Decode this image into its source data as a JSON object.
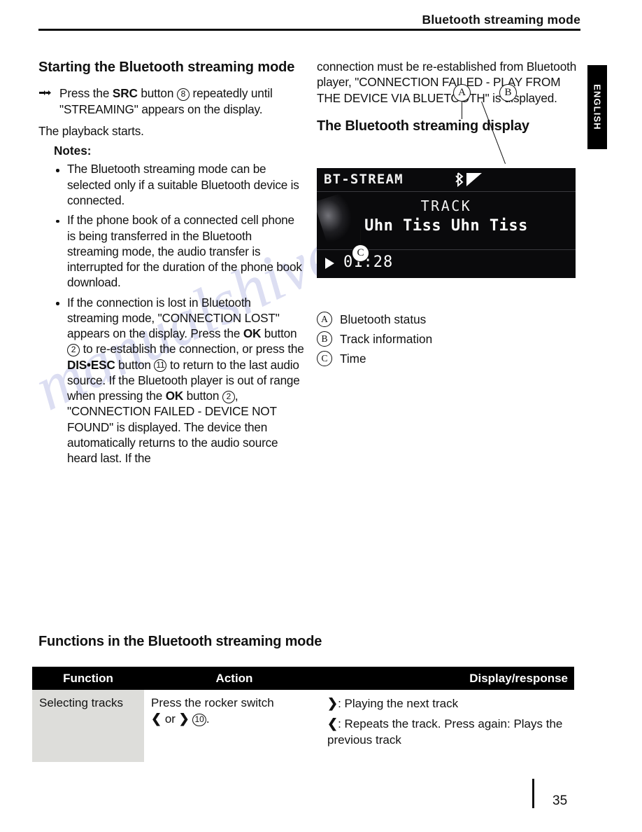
{
  "header": {
    "title": "Bluetooth streaming mode"
  },
  "side_tab": {
    "label": "ENGLISH"
  },
  "left_column": {
    "heading": "Starting the Bluetooth streaming mode",
    "step": {
      "icon": "hand-pointer-icon",
      "text_before_bold": "Press the ",
      "bold": "SRC",
      "text_mid": " button ",
      "ref": "8",
      "text_after": " repeatedly until \"STREAMING\" appears on the display."
    },
    "after_step": "The playback starts.",
    "notes_heading": "Notes:",
    "notes": [
      {
        "text": "The Bluetooth streaming mode can be selected only if a suitable Bluetooth device is connected."
      },
      {
        "text": "If the phone book of a connected cell phone is being transferred in the Bluetooth streaming mode, the audio transfer is interrupted for the duration of the phone book download."
      },
      {
        "part1": "If the connection is lost in Bluetooth streaming mode, \"CONNECTION LOST\" appears on the display. Press the ",
        "bold1": "OK",
        "part2": " button ",
        "ref1": "2",
        "part3": " to re-establish the connection, or press the ",
        "bold2": "DIS•ESC",
        "part4": " button ",
        "ref2": "11",
        "part5": " to return to the last audio source. If the Bluetooth player is out of range when pressing the ",
        "bold3": "OK",
        "part6": " button ",
        "ref3": "2",
        "part7": ", \"CONNECTION FAILED - DEVICE NOT FOUND\" is displayed. The device then automatically returns to the audio source heard last. If the"
      }
    ]
  },
  "right_column": {
    "continued_text": "connection must be re-established from Bluetooth player, \"CONNECTION FAILED - PLAY FROM THE DEVICE VIA BLUETOOTH\" is displayed.",
    "display_heading": "The Bluetooth streaming display",
    "lcd": {
      "mode": "BT-STREAM",
      "bt_icon": "bluetooth-icon",
      "signal_icon": "signal-strength-icon",
      "track_label": "TRACK",
      "track_name": "Uhn Tiss Uhn Tiss",
      "play_icon": "play-icon",
      "time": "01:28"
    },
    "callouts": [
      {
        "id": "A"
      },
      {
        "id": "B"
      },
      {
        "id": "C"
      }
    ],
    "legend": [
      {
        "id": "A",
        "label": "Bluetooth status"
      },
      {
        "id": "B",
        "label": "Track information"
      },
      {
        "id": "C",
        "label": "Time"
      }
    ]
  },
  "functions": {
    "heading": "Functions in the Bluetooth streaming mode",
    "columns": [
      "Function",
      "Action",
      "Display/response"
    ],
    "rows": [
      {
        "function": "Selecting tracks",
        "action_before": "Press the rocker switch ",
        "action_sym1": "❮",
        "action_or": " or ",
        "action_sym2": "❯",
        "action_ref": "10",
        "action_after": ".",
        "response_line1_sym": "❯",
        "response_line1": ": Playing the next track",
        "response_line2_sym": "❮",
        "response_line2": ": Repeats the track. Press again: Plays the previous track"
      }
    ]
  },
  "footer": {
    "page_number": "35"
  },
  "watermark": {
    "text": "manualshive.com"
  }
}
